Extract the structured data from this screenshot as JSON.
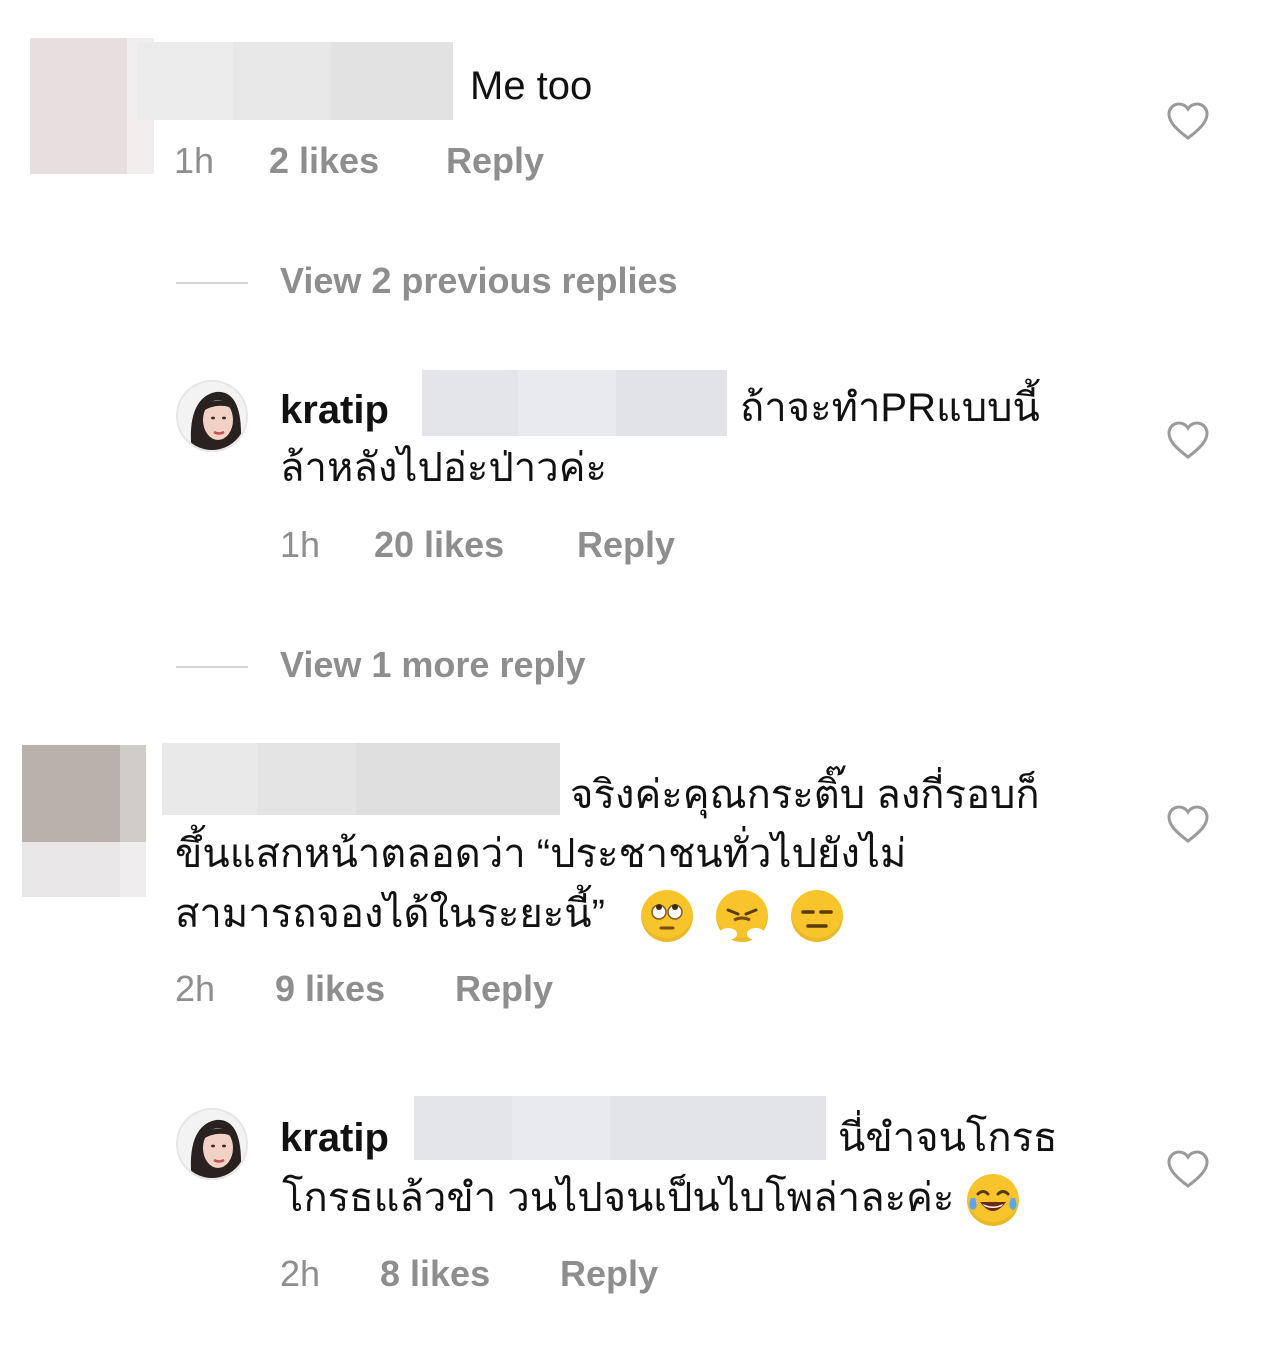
{
  "comments": [
    {
      "username": "",
      "text": "Me too",
      "time": "1h",
      "likes": "2 likes",
      "reply": "Reply"
    },
    {
      "username": "kratip",
      "text_line1": "ถ้าจะทำPRแบบนี้",
      "text_line2": "ล้าหลังไปอ่ะป่าวค่ะ",
      "time": "1h",
      "likes": "20 likes",
      "reply": "Reply"
    },
    {
      "username": "",
      "text_line1": "จริงค่ะคุณกระติ๊บ ลงกี่รอบก็",
      "text_line2": "ขึ้นแสกหน้าตลอดว่า “ประชาชนทั่วไปยังไม่",
      "text_line3": "สามารถจองได้ในระยะนี้”",
      "emojis": [
        "eye-roll-emoji",
        "steam-nose-emoji",
        "expressionless-emoji"
      ],
      "time": "2h",
      "likes": "9 likes",
      "reply": "Reply"
    },
    {
      "username": "kratip",
      "text_line1": "นี่ขำจนโกรธ",
      "text_line2": "โกรธแล้วขำ วนไปจนเป็นไบโพล่าละค่ะ",
      "emojis": [
        "tears-of-joy-emoji"
      ],
      "time": "2h",
      "likes": "8 likes",
      "reply": "Reply"
    }
  ],
  "view_replies": [
    {
      "label": "View 2 previous replies"
    },
    {
      "label": "View 1 more reply"
    }
  ]
}
